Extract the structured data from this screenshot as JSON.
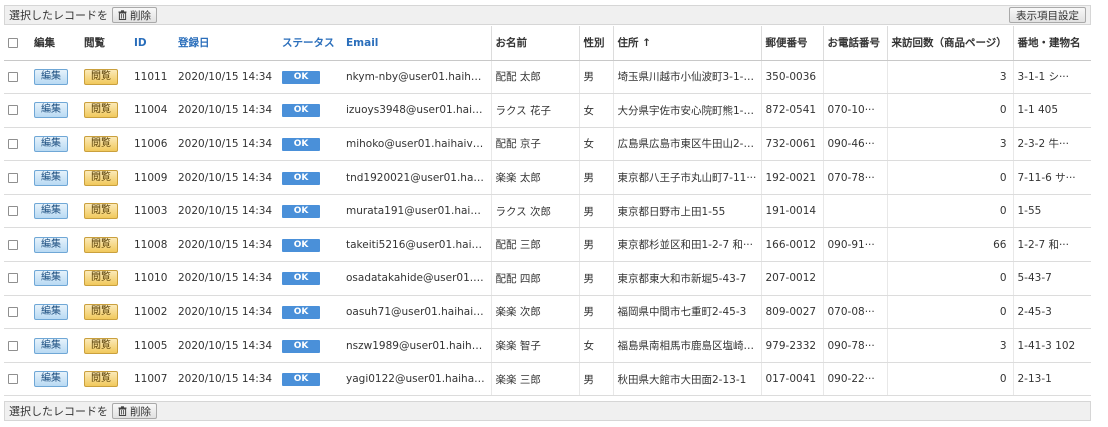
{
  "toolbar": {
    "selected_label": "選択したレコードを",
    "delete_label": "削除",
    "display_settings_label": "表示項目設定"
  },
  "columns": {
    "edit": "編集",
    "view": "閲覧",
    "id": "ID",
    "registered": "登録日",
    "status": "ステータス",
    "email": "Email",
    "name": "お名前",
    "gender": "性別",
    "address": "住所",
    "address_sort": "↑",
    "postal": "郵便番号",
    "phone": "お電話番号",
    "visits": "来訪回数（商品ページ）",
    "lot": "番地・建物名"
  },
  "row_buttons": {
    "edit": "編集",
    "view": "閲覧",
    "status": "OK"
  },
  "rows": [
    {
      "id": "11011",
      "date": "2020/10/15 14:34",
      "email": "nkym-nby@user01.haihai···",
      "name": "配配 太郎",
      "gender": "男",
      "address": "埼玉県川越市小仙波町3-1-1···",
      "postal": "350-0036",
      "phone": "",
      "visits": "3",
      "lot": "3-1-1 シ···"
    },
    {
      "id": "11004",
      "date": "2020/10/15 14:34",
      "email": "izuoys3948@user01.haih···",
      "name": "ラクス 花子",
      "gender": "女",
      "address": "大分県宇佐市安心院町熊1-1···",
      "postal": "872-0541",
      "phone": "070-10···",
      "visits": "0",
      "lot": "1-1 405"
    },
    {
      "id": "11006",
      "date": "2020/10/15 14:34",
      "email": "mihoko@user01.haihaivm···",
      "name": "配配 京子",
      "gender": "女",
      "address": "広島県広島市東区牛田山2-3···",
      "postal": "732-0061",
      "phone": "090-46···",
      "visits": "3",
      "lot": "2-3-2 牛···"
    },
    {
      "id": "11009",
      "date": "2020/10/15 14:34",
      "email": "tnd1920021@user01.haih···",
      "name": "楽楽 太郎",
      "gender": "男",
      "address": "東京都八王子市丸山町7-11···",
      "postal": "192-0021",
      "phone": "070-78···",
      "visits": "0",
      "lot": "7-11-6 サ···"
    },
    {
      "id": "11003",
      "date": "2020/10/15 14:34",
      "email": "murata191@user01.haiha···",
      "name": "ラクス 次郎",
      "gender": "男",
      "address": "東京都日野市上田1-55",
      "postal": "191-0014",
      "phone": "",
      "visits": "0",
      "lot": "1-55"
    },
    {
      "id": "11008",
      "date": "2020/10/15 14:34",
      "email": "takeiti5216@user01.haiha···",
      "name": "配配 三郎",
      "gender": "男",
      "address": "東京都杉並区和田1-2-7 和···",
      "postal": "166-0012",
      "phone": "090-91···",
      "visits": "66",
      "lot": "1-2-7 和···"
    },
    {
      "id": "11010",
      "date": "2020/10/15 14:34",
      "email": "osadatakahide@user01.h···",
      "name": "配配 四郎",
      "gender": "男",
      "address": "東京都東大和市新堀5-43-7",
      "postal": "207-0012",
      "phone": "",
      "visits": "0",
      "lot": "5-43-7"
    },
    {
      "id": "11002",
      "date": "2020/10/15 14:34",
      "email": "oasuh71@user01.haihaiv···",
      "name": "楽楽 次郎",
      "gender": "男",
      "address": "福岡県中間市七重町2-45-3",
      "postal": "809-0027",
      "phone": "070-08···",
      "visits": "0",
      "lot": "2-45-3"
    },
    {
      "id": "11005",
      "date": "2020/10/15 14:34",
      "email": "nszw1989@user01.haihai···",
      "name": "楽楽 智子",
      "gender": "女",
      "address": "福島県南相馬市鹿島区塩崎1···",
      "postal": "979-2332",
      "phone": "090-78···",
      "visits": "3",
      "lot": "1-41-3 102"
    },
    {
      "id": "11007",
      "date": "2020/10/15 14:34",
      "email": "yagi0122@user01.haihaiv···",
      "name": "楽楽 三郎",
      "gender": "男",
      "address": "秋田県大館市大田面2-13-1",
      "postal": "017-0041",
      "phone": "090-22···",
      "visits": "0",
      "lot": "2-13-1"
    }
  ]
}
